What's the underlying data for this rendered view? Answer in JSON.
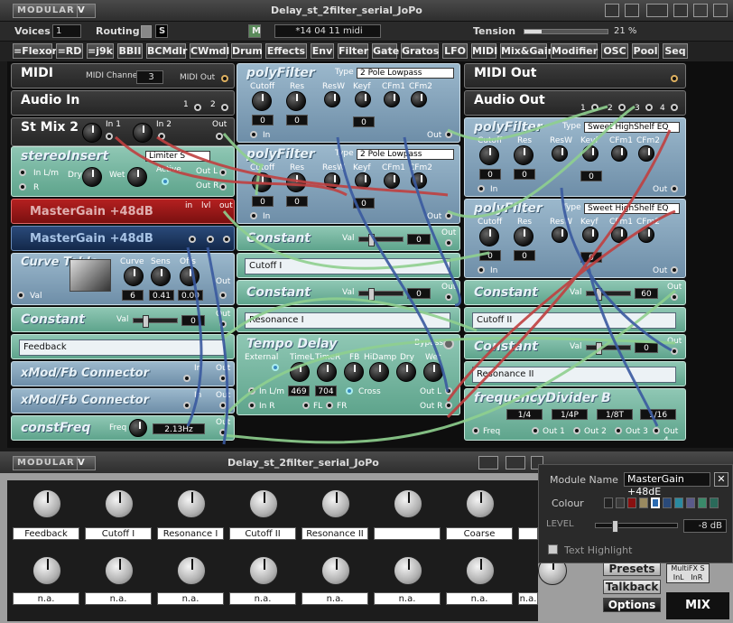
{
  "app": {
    "logo": "MODULAR",
    "logo_v": "V",
    "title": "Delay_st_2filter_serial_JoPo"
  },
  "toolbar": {
    "voices_label": "Voices",
    "voices_value": "1",
    "routing_label": "Routing",
    "routing_s": "S",
    "routing_m": "M",
    "routing_colors": [
      "#e02020",
      "#e0a020",
      "#e0e020",
      "#3060e0",
      "#e040c0"
    ],
    "time_value": "*14 04 11 midi",
    "tension_label": "Tension",
    "tension_value": "21 %",
    "tension_fraction": 0.21
  },
  "categories": [
    "=Flexor",
    "=RD",
    "=j9k",
    "BBII",
    "BCMdlr",
    "CWmdl",
    "Drum",
    "Effects",
    "Env",
    "Filter",
    "Gate",
    "Gratos",
    "LFO",
    "MIDI",
    "Mix&Gain",
    "Modifier",
    "OSC",
    "Pool",
    "Seq"
  ],
  "modules": {
    "midi": {
      "title": "MIDI",
      "channel_label": "MIDI Channel",
      "channel_value": "3",
      "out": "MIDI Out"
    },
    "audio_in": {
      "title": "Audio In",
      "p1": "1",
      "p2": "2"
    },
    "stmix": {
      "title": "St Mix 2",
      "in1": "In 1",
      "in2": "In 2",
      "out": "Out"
    },
    "stereo_insert": {
      "title": "stereoInsert",
      "combo": "Limiter S",
      "dry": "Dry",
      "wet": "Wet",
      "active": "Active",
      "in": "In L/m",
      "r": "R",
      "out_l": "Out L",
      "out_r": "Out R"
    },
    "mastergain1": {
      "title": "MasterGain +48dB",
      "in": "in",
      "lvl": "lvl",
      "out": "out"
    },
    "mastergain2": {
      "title": "MasterGain +48dB"
    },
    "curve_table": {
      "title": "Curve Table",
      "curve": "Curve",
      "sens": "Sens",
      "offs": "Offs",
      "curve_val": "6",
      "sens_val": "0.41",
      "offs_val": "0.00",
      "val": "Val",
      "out": "Out"
    },
    "constant_left": {
      "title": "Constant",
      "val_label": "Val",
      "value": "0",
      "out": "Out"
    },
    "feedback_field": "Feedback",
    "xmod1": {
      "title": "xMod/Fb Connector",
      "in": "In",
      "out": "Out"
    },
    "xmod2": {
      "title": "xMod/Fb Connector",
      "in": "In",
      "out": "Out"
    },
    "constfreq": {
      "title": "constFreq",
      "freq": "Freq",
      "value": "2.13Hz",
      "out": "Out"
    },
    "polyfilter1": {
      "title": "polyFilter",
      "type_label": "Type",
      "type": "2 Pole Lowpass",
      "cutoff": "Cutoff",
      "res": "Res",
      "resw": "ResW",
      "keyf": "Keyf",
      "cfm1": "CFm1",
      "cfm2": "CFm2",
      "cutoff_val": "0",
      "res_val": "0",
      "keyf_val": "0",
      "in": "In",
      "out": "Out"
    },
    "polyfilter2": {
      "title": "polyFilter",
      "type_label": "Type",
      "type": "2 Pole Lowpass",
      "cutoff": "Cutoff",
      "res": "Res",
      "resw": "ResW",
      "keyf": "Keyf",
      "cfm1": "CFm1",
      "cfm2": "CFm2",
      "cutoff_val": "0",
      "res_val": "0",
      "keyf_val": "0",
      "in": "In",
      "out": "Out"
    },
    "constant_mid1": {
      "title": "Constant",
      "val_label": "Val",
      "value": "0",
      "out": "Out"
    },
    "cutoff_field": "Cutoff I",
    "constant_mid2": {
      "title": "Constant",
      "val_label": "Val",
      "value": "0",
      "out": "Out"
    },
    "resonance_field": "Resonance I",
    "tempo_delay": {
      "title": "Tempo Delay",
      "bypass": "Bypass",
      "external": "External",
      "timel": "TimeL",
      "timer": "TimeR",
      "fb": "FB",
      "hidamp": "HiDamp",
      "dry": "Dry",
      "wet": "Wet",
      "timel_val": "469",
      "timer_val": "704",
      "cross": "Cross",
      "in": "In L/m",
      "inr": "In R",
      "fl": "FL",
      "fr": "FR",
      "outl": "Out L",
      "outr": "Out R"
    },
    "midi_out": {
      "title": "MIDI Out"
    },
    "audio_out": {
      "title": "Audio Out",
      "p1": "1",
      "p2": "2",
      "p3": "3",
      "p4": "4"
    },
    "polyfilter3": {
      "title": "polyFilter",
      "type_label": "Type",
      "type": "Sweet HighShelf EQ",
      "cutoff": "Cutoff",
      "res": "Res",
      "resw": "ResW",
      "keyf": "Keyf",
      "cfm1": "CFm1",
      "cfm2": "CFm2",
      "cutoff_val": "0",
      "res_val": "0",
      "keyf_val": "0",
      "in": "In",
      "out": "Out"
    },
    "polyfilter4": {
      "title": "polyFilter",
      "type_label": "Type",
      "type": "Sweet HighShelf EQ",
      "cutoff": "Cutoff",
      "res": "Res",
      "resw": "ResW",
      "keyf": "Keyf",
      "cfm1": "CFm1",
      "cfm2": "CFm2",
      "cutoff_val": "0",
      "res_val": "0",
      "keyf_val": "0",
      "in": "In",
      "out": "Out"
    },
    "constant_r1": {
      "title": "Constant",
      "val_label": "Val",
      "value": "60",
      "out": "Out"
    },
    "cutoff2_field": "Cutoff II",
    "constant_r2": {
      "title": "Constant",
      "val_label": "Val",
      "value": "0",
      "out": "Out"
    },
    "resonance2_field": "Resonance II",
    "freq_divider": {
      "title": "frequencyDivider B",
      "b1": "1/4",
      "b2": "1/4P",
      "b3": "1/8T",
      "b4": "1/16",
      "freq": "Freq",
      "out1": "Out 1",
      "out2": "Out 2",
      "out3": "Out 3",
      "out4": "Out 4"
    }
  },
  "bottom": {
    "logo": "MODULAR",
    "logo_v": "V",
    "title": "Delay_st_2filter_serial_JoPo",
    "top_labels": [
      "Feedback",
      "Cutoff I",
      "Resonance I",
      "Cutoff II",
      "Resonance II",
      "",
      "Coarse",
      ""
    ],
    "bottom_labels": [
      "n.a.",
      "n.a.",
      "n.a.",
      "n.a.",
      "n.a.",
      "n.a.",
      "n.a.",
      "n.a."
    ],
    "presets": "Presets",
    "talkback": "Talkback",
    "options": "Options",
    "mix": "MIX",
    "mix_box": "MultiFX S",
    "inl": "InL",
    "inr": "InR"
  },
  "popup": {
    "module_name_label": "Module Name",
    "module_name_value": "MasterGain +48dE",
    "colour_label": "Colour",
    "colours": [
      "#222222",
      "#3a3a3a",
      "#8a1010",
      "#9a8a60",
      "#2a6ab0",
      "#2a4a7a",
      "#2a8aa0",
      "#5a5a8a",
      "#3a8a6a",
      "#2a6a5a"
    ],
    "level_label": "LEVEL",
    "level_value": "-8 dB",
    "text_highlight": "Text Highlight"
  }
}
